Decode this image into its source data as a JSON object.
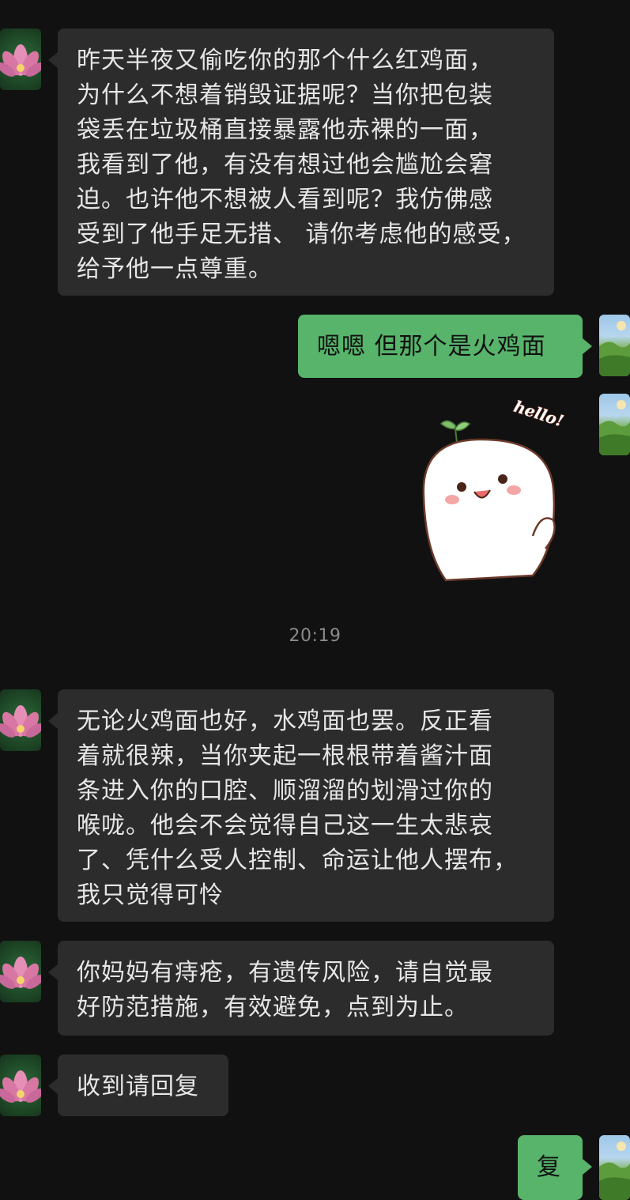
{
  "chat": {
    "messages": [
      {
        "side": "left",
        "text": "昨天半夜又偷吃你的那个什么红鸡面，\n为什么不想着销毁证据呢？当你把包装\n袋丢在垃圾桶直接暴露他赤裸的一面，\n我看到了他，有没有想过他会尴尬会窘\n迫。也许他不想被人看到呢？我仿佛感\n受到了他手足无措、 请你考虑他的感受，\n给予他一点尊重。"
      },
      {
        "side": "right",
        "text": "嗯嗯 但那个是火鸡面"
      },
      {
        "side": "right",
        "sticker_text": "hello!"
      },
      {
        "side": "left",
        "text": "无论火鸡面也好，水鸡面也罢。反正看\n着就很辣，当你夹起一根根带着酱汁面\n条进入你的口腔、顺溜溜的划滑过你的\n喉咙。他会不会觉得自己这一生太悲哀\n了、凭什么受人控制、命运让他人摆布，\n我只觉得可怜"
      },
      {
        "side": "left",
        "text": "你妈妈有痔疮，有遗传风险，请自觉最\n好防范措施，有效避免，点到为止。"
      },
      {
        "side": "left",
        "text": "收到请回复"
      },
      {
        "side": "right",
        "text": "复"
      }
    ],
    "timestamp": "20:19"
  },
  "avatars": {
    "contact": "lotus-flower-avatar",
    "self": "scenery-avatar"
  },
  "colors": {
    "background": "#111111",
    "incoming_bubble": "#2c2c2c",
    "outgoing_bubble": "#57b46a",
    "timestamp": "#8a8a8a"
  }
}
